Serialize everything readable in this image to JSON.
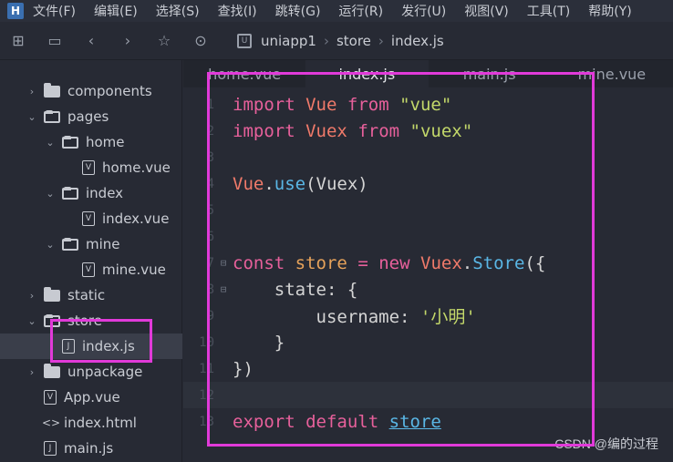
{
  "menu": {
    "logo": "H",
    "items": [
      "文件(F)",
      "编辑(E)",
      "选择(S)",
      "查找(I)",
      "跳转(G)",
      "运行(R)",
      "发行(U)",
      "视图(V)",
      "工具(T)",
      "帮助(Y)"
    ]
  },
  "toolbar": {
    "breadcrumb": [
      "uniapp1",
      "store",
      "index.js"
    ]
  },
  "sidebar": {
    "items": [
      {
        "label": "components"
      },
      {
        "label": "pages"
      },
      {
        "label": "home"
      },
      {
        "label": "home.vue"
      },
      {
        "label": "index"
      },
      {
        "label": "index.vue"
      },
      {
        "label": "mine"
      },
      {
        "label": "mine.vue"
      },
      {
        "label": "static"
      },
      {
        "label": "store"
      },
      {
        "label": "index.js"
      },
      {
        "label": "unpackage"
      },
      {
        "label": "App.vue"
      },
      {
        "label": "index.html"
      },
      {
        "label": "main.js"
      }
    ]
  },
  "tabs": [
    "home.vue",
    "index.js",
    "main.js",
    "mine.vue"
  ],
  "editor": {
    "line_numbers": [
      "1",
      "2",
      "3",
      "4",
      "5",
      "6",
      "7",
      "8",
      "9",
      "10",
      "11",
      "12",
      "13"
    ],
    "lines": {
      "l1": [
        "import",
        "Vue",
        "from",
        "\"vue\""
      ],
      "l2": [
        "import",
        "Vuex",
        "from",
        "\"vuex\""
      ],
      "l4": [
        "Vue",
        ".",
        "use",
        "(Vuex)"
      ],
      "l7": [
        "const",
        "store",
        "=",
        "new",
        "Vuex",
        ".",
        "Store",
        "({"
      ],
      "l8": [
        "state",
        ": {"
      ],
      "l9": [
        "username",
        ": ",
        "'小明'"
      ],
      "l10": [
        "}"
      ],
      "l11": [
        "})"
      ],
      "l13": [
        "export",
        "default",
        "store"
      ]
    }
  },
  "watermark": "CSDN @编的过程"
}
